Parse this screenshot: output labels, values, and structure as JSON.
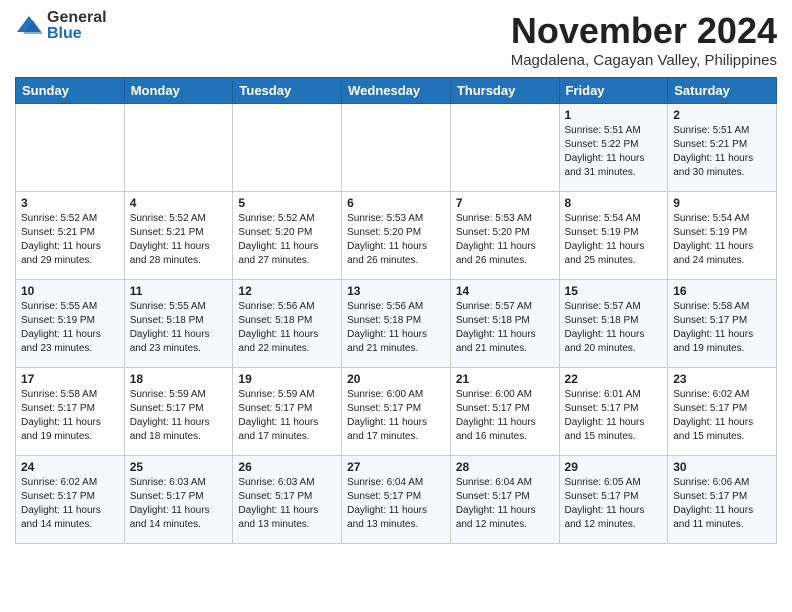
{
  "logo": {
    "general": "General",
    "blue": "Blue"
  },
  "header": {
    "month": "November 2024",
    "location": "Magdalena, Cagayan Valley, Philippines"
  },
  "weekdays": [
    "Sunday",
    "Monday",
    "Tuesday",
    "Wednesday",
    "Thursday",
    "Friday",
    "Saturday"
  ],
  "weeks": [
    [
      {
        "day": "",
        "info": ""
      },
      {
        "day": "",
        "info": ""
      },
      {
        "day": "",
        "info": ""
      },
      {
        "day": "",
        "info": ""
      },
      {
        "day": "",
        "info": ""
      },
      {
        "day": "1",
        "info": "Sunrise: 5:51 AM\nSunset: 5:22 PM\nDaylight: 11 hours\nand 31 minutes."
      },
      {
        "day": "2",
        "info": "Sunrise: 5:51 AM\nSunset: 5:21 PM\nDaylight: 11 hours\nand 30 minutes."
      }
    ],
    [
      {
        "day": "3",
        "info": "Sunrise: 5:52 AM\nSunset: 5:21 PM\nDaylight: 11 hours\nand 29 minutes."
      },
      {
        "day": "4",
        "info": "Sunrise: 5:52 AM\nSunset: 5:21 PM\nDaylight: 11 hours\nand 28 minutes."
      },
      {
        "day": "5",
        "info": "Sunrise: 5:52 AM\nSunset: 5:20 PM\nDaylight: 11 hours\nand 27 minutes."
      },
      {
        "day": "6",
        "info": "Sunrise: 5:53 AM\nSunset: 5:20 PM\nDaylight: 11 hours\nand 26 minutes."
      },
      {
        "day": "7",
        "info": "Sunrise: 5:53 AM\nSunset: 5:20 PM\nDaylight: 11 hours\nand 26 minutes."
      },
      {
        "day": "8",
        "info": "Sunrise: 5:54 AM\nSunset: 5:19 PM\nDaylight: 11 hours\nand 25 minutes."
      },
      {
        "day": "9",
        "info": "Sunrise: 5:54 AM\nSunset: 5:19 PM\nDaylight: 11 hours\nand 24 minutes."
      }
    ],
    [
      {
        "day": "10",
        "info": "Sunrise: 5:55 AM\nSunset: 5:19 PM\nDaylight: 11 hours\nand 23 minutes."
      },
      {
        "day": "11",
        "info": "Sunrise: 5:55 AM\nSunset: 5:18 PM\nDaylight: 11 hours\nand 23 minutes."
      },
      {
        "day": "12",
        "info": "Sunrise: 5:56 AM\nSunset: 5:18 PM\nDaylight: 11 hours\nand 22 minutes."
      },
      {
        "day": "13",
        "info": "Sunrise: 5:56 AM\nSunset: 5:18 PM\nDaylight: 11 hours\nand 21 minutes."
      },
      {
        "day": "14",
        "info": "Sunrise: 5:57 AM\nSunset: 5:18 PM\nDaylight: 11 hours\nand 21 minutes."
      },
      {
        "day": "15",
        "info": "Sunrise: 5:57 AM\nSunset: 5:18 PM\nDaylight: 11 hours\nand 20 minutes."
      },
      {
        "day": "16",
        "info": "Sunrise: 5:58 AM\nSunset: 5:17 PM\nDaylight: 11 hours\nand 19 minutes."
      }
    ],
    [
      {
        "day": "17",
        "info": "Sunrise: 5:58 AM\nSunset: 5:17 PM\nDaylight: 11 hours\nand 19 minutes."
      },
      {
        "day": "18",
        "info": "Sunrise: 5:59 AM\nSunset: 5:17 PM\nDaylight: 11 hours\nand 18 minutes."
      },
      {
        "day": "19",
        "info": "Sunrise: 5:59 AM\nSunset: 5:17 PM\nDaylight: 11 hours\nand 17 minutes."
      },
      {
        "day": "20",
        "info": "Sunrise: 6:00 AM\nSunset: 5:17 PM\nDaylight: 11 hours\nand 17 minutes."
      },
      {
        "day": "21",
        "info": "Sunrise: 6:00 AM\nSunset: 5:17 PM\nDaylight: 11 hours\nand 16 minutes."
      },
      {
        "day": "22",
        "info": "Sunrise: 6:01 AM\nSunset: 5:17 PM\nDaylight: 11 hours\nand 15 minutes."
      },
      {
        "day": "23",
        "info": "Sunrise: 6:02 AM\nSunset: 5:17 PM\nDaylight: 11 hours\nand 15 minutes."
      }
    ],
    [
      {
        "day": "24",
        "info": "Sunrise: 6:02 AM\nSunset: 5:17 PM\nDaylight: 11 hours\nand 14 minutes."
      },
      {
        "day": "25",
        "info": "Sunrise: 6:03 AM\nSunset: 5:17 PM\nDaylight: 11 hours\nand 14 minutes."
      },
      {
        "day": "26",
        "info": "Sunrise: 6:03 AM\nSunset: 5:17 PM\nDaylight: 11 hours\nand 13 minutes."
      },
      {
        "day": "27",
        "info": "Sunrise: 6:04 AM\nSunset: 5:17 PM\nDaylight: 11 hours\nand 13 minutes."
      },
      {
        "day": "28",
        "info": "Sunrise: 6:04 AM\nSunset: 5:17 PM\nDaylight: 11 hours\nand 12 minutes."
      },
      {
        "day": "29",
        "info": "Sunrise: 6:05 AM\nSunset: 5:17 PM\nDaylight: 11 hours\nand 12 minutes."
      },
      {
        "day": "30",
        "info": "Sunrise: 6:06 AM\nSunset: 5:17 PM\nDaylight: 11 hours\nand 11 minutes."
      }
    ]
  ]
}
